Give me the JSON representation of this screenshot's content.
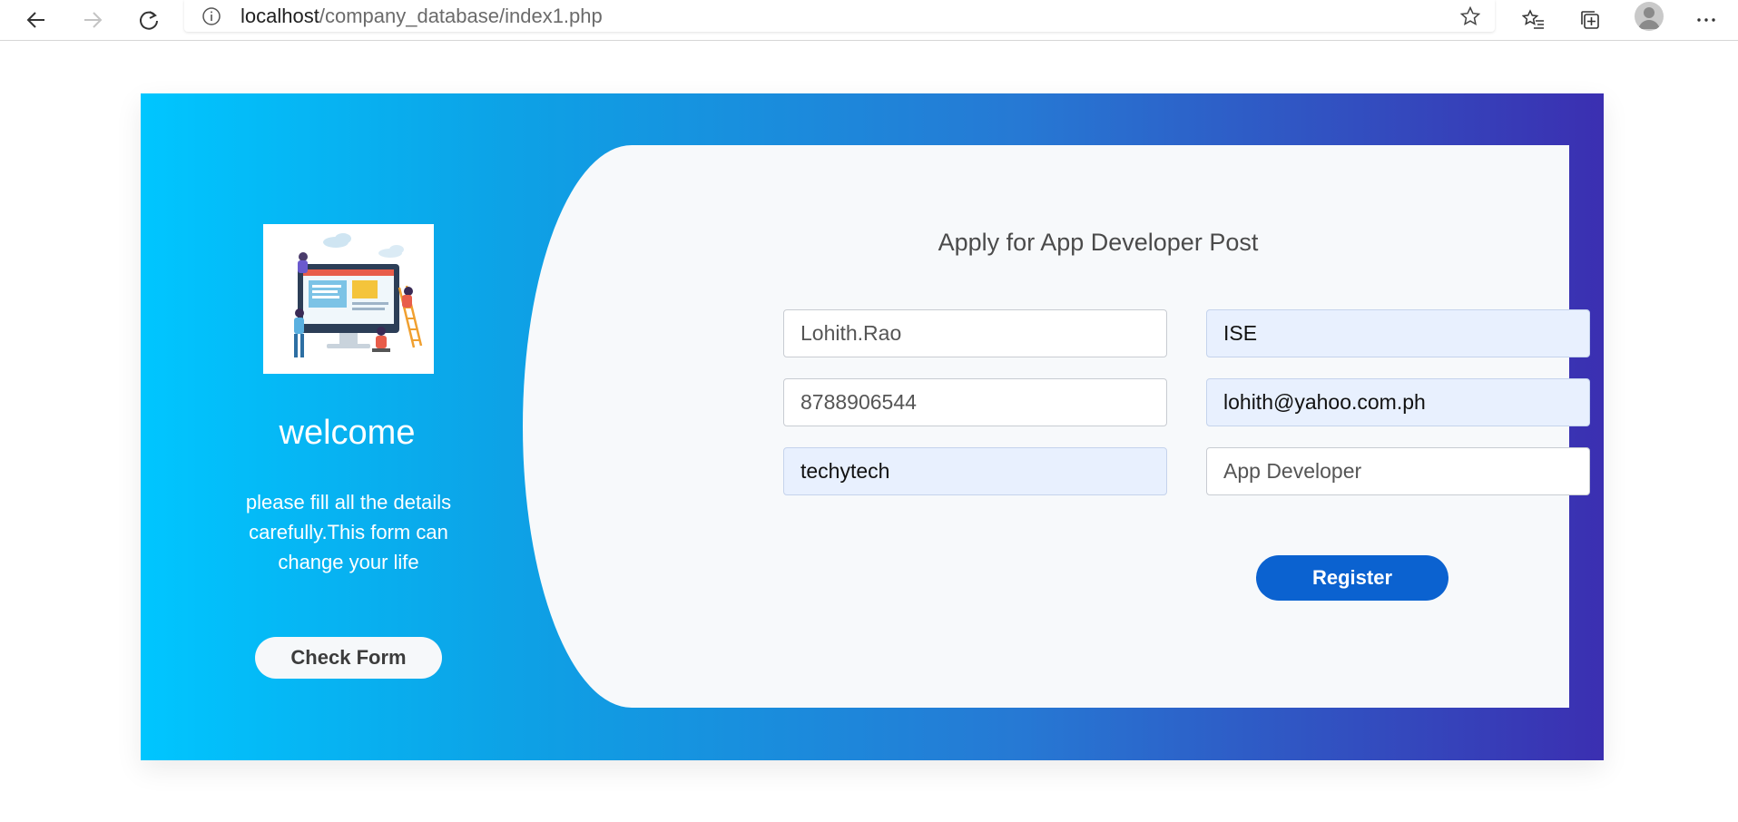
{
  "browser": {
    "url_host": "localhost",
    "url_path": "/company_database/index1.php",
    "icons": [
      "back-arrow-icon",
      "forward-arrow-icon",
      "refresh-icon",
      "info-icon",
      "star-icon",
      "favorites-icon",
      "collections-icon",
      "profile-icon",
      "more-icon"
    ]
  },
  "welcome_panel": {
    "heading": "welcome",
    "message": "please fill all the details carefully.This form can change your life",
    "check_form_label": "Check Form"
  },
  "form": {
    "title": "Apply for App Developer Post",
    "fields": {
      "name": "Lohith.Rao",
      "branch": "ISE",
      "phone": "8788906544",
      "email": "lohith@yahoo.com.ph",
      "company": "techytech",
      "post": "App Developer"
    },
    "register_label": "Register"
  },
  "colors": {
    "gradient_start": "#00c6ff",
    "gradient_end": "#3b2fb1",
    "register_button": "#0b62d0",
    "autofill_field": "#e8f0fe"
  }
}
